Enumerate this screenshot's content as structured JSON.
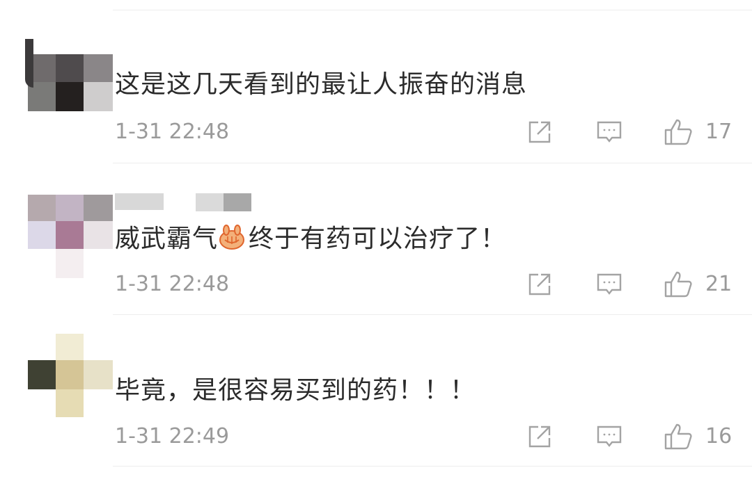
{
  "comments": [
    {
      "text": "这是这几天看到的最让人振奋的消息",
      "time": "1-31 22:48",
      "likes": "17"
    },
    {
      "text_before_emoji": "威武霸气",
      "emoji": "emoji-fist-cupped",
      "text_after_emoji": "终于有药可以治疗了！",
      "time": "1-31 22:48",
      "likes": "21"
    },
    {
      "text": "毕竟，是很容易买到的药！！！",
      "time": "1-31 22:49",
      "likes": "16"
    }
  ],
  "icons": {
    "repost": "repost-icon",
    "reply": "comment-icon",
    "like": "thumbs-up-icon"
  },
  "colors": {
    "text": "#2b2b2b",
    "meta": "#9a9a9a",
    "icon": "#a3a3a3",
    "divider": "#ededed"
  }
}
